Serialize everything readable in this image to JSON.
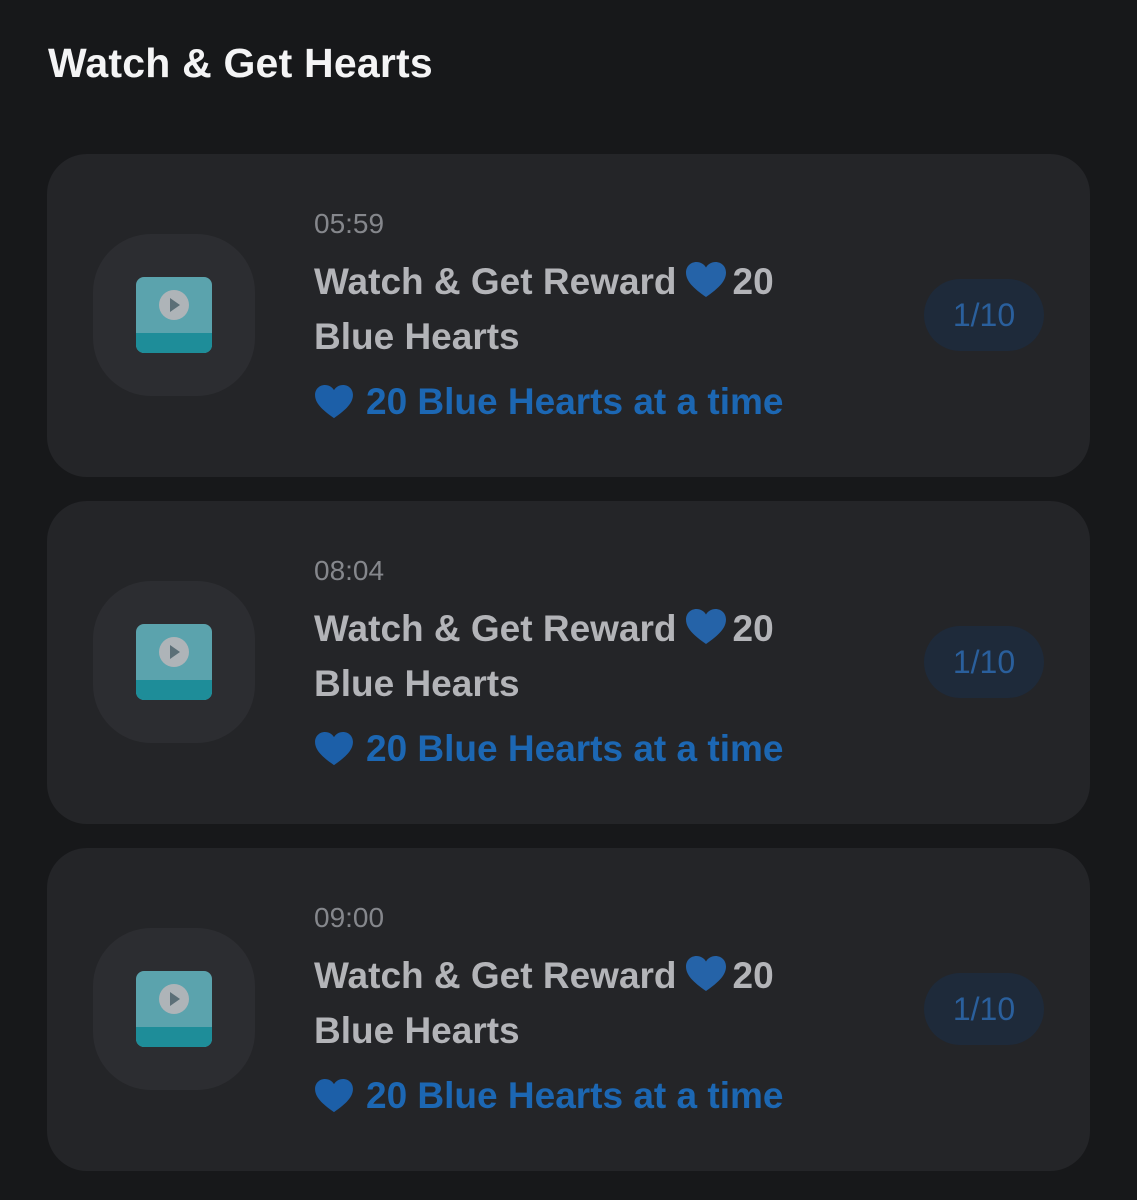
{
  "header": {
    "title": "Watch & Get Hearts"
  },
  "colors": {
    "background": "#17181a",
    "card": "#242528",
    "accent_blue": "#1c67b3",
    "heart_blue": "#2563a8",
    "video_icon_teal": "#5ba3ad"
  },
  "tasks": [
    {
      "icon": "video-play-icon",
      "time": "05:59",
      "title_before_heart": "Watch & Get Reward",
      "title_after_heart": "20 Blue Hearts",
      "reward_text": "20 Blue Hearts at a time",
      "progress": "1/10"
    },
    {
      "icon": "video-play-icon",
      "time": "08:04",
      "title_before_heart": "Watch & Get Reward",
      "title_after_heart": "20 Blue Hearts",
      "reward_text": "20 Blue Hearts at a time",
      "progress": "1/10"
    },
    {
      "icon": "video-play-icon",
      "time": "09:00",
      "title_before_heart": "Watch & Get Reward",
      "title_after_heart": "20 Blue Hearts",
      "reward_text": "20 Blue Hearts at a time",
      "progress": "1/10"
    }
  ]
}
